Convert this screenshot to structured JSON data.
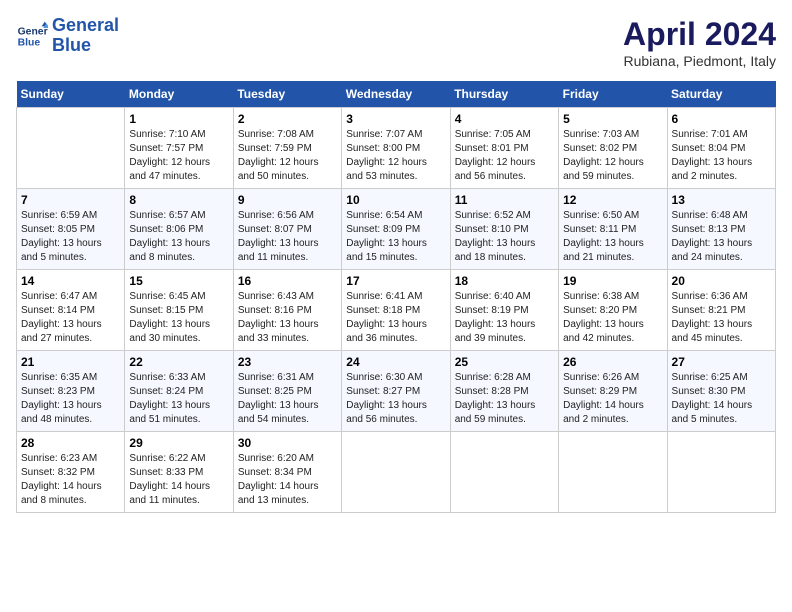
{
  "header": {
    "logo_line1": "General",
    "logo_line2": "Blue",
    "month": "April 2024",
    "location": "Rubiana, Piedmont, Italy"
  },
  "days_of_week": [
    "Sunday",
    "Monday",
    "Tuesday",
    "Wednesday",
    "Thursday",
    "Friday",
    "Saturday"
  ],
  "weeks": [
    [
      {
        "day": "",
        "info": ""
      },
      {
        "day": "1",
        "info": "Sunrise: 7:10 AM\nSunset: 7:57 PM\nDaylight: 12 hours\nand 47 minutes."
      },
      {
        "day": "2",
        "info": "Sunrise: 7:08 AM\nSunset: 7:59 PM\nDaylight: 12 hours\nand 50 minutes."
      },
      {
        "day": "3",
        "info": "Sunrise: 7:07 AM\nSunset: 8:00 PM\nDaylight: 12 hours\nand 53 minutes."
      },
      {
        "day": "4",
        "info": "Sunrise: 7:05 AM\nSunset: 8:01 PM\nDaylight: 12 hours\nand 56 minutes."
      },
      {
        "day": "5",
        "info": "Sunrise: 7:03 AM\nSunset: 8:02 PM\nDaylight: 12 hours\nand 59 minutes."
      },
      {
        "day": "6",
        "info": "Sunrise: 7:01 AM\nSunset: 8:04 PM\nDaylight: 13 hours\nand 2 minutes."
      }
    ],
    [
      {
        "day": "7",
        "info": "Sunrise: 6:59 AM\nSunset: 8:05 PM\nDaylight: 13 hours\nand 5 minutes."
      },
      {
        "day": "8",
        "info": "Sunrise: 6:57 AM\nSunset: 8:06 PM\nDaylight: 13 hours\nand 8 minutes."
      },
      {
        "day": "9",
        "info": "Sunrise: 6:56 AM\nSunset: 8:07 PM\nDaylight: 13 hours\nand 11 minutes."
      },
      {
        "day": "10",
        "info": "Sunrise: 6:54 AM\nSunset: 8:09 PM\nDaylight: 13 hours\nand 15 minutes."
      },
      {
        "day": "11",
        "info": "Sunrise: 6:52 AM\nSunset: 8:10 PM\nDaylight: 13 hours\nand 18 minutes."
      },
      {
        "day": "12",
        "info": "Sunrise: 6:50 AM\nSunset: 8:11 PM\nDaylight: 13 hours\nand 21 minutes."
      },
      {
        "day": "13",
        "info": "Sunrise: 6:48 AM\nSunset: 8:13 PM\nDaylight: 13 hours\nand 24 minutes."
      }
    ],
    [
      {
        "day": "14",
        "info": "Sunrise: 6:47 AM\nSunset: 8:14 PM\nDaylight: 13 hours\nand 27 minutes."
      },
      {
        "day": "15",
        "info": "Sunrise: 6:45 AM\nSunset: 8:15 PM\nDaylight: 13 hours\nand 30 minutes."
      },
      {
        "day": "16",
        "info": "Sunrise: 6:43 AM\nSunset: 8:16 PM\nDaylight: 13 hours\nand 33 minutes."
      },
      {
        "day": "17",
        "info": "Sunrise: 6:41 AM\nSunset: 8:18 PM\nDaylight: 13 hours\nand 36 minutes."
      },
      {
        "day": "18",
        "info": "Sunrise: 6:40 AM\nSunset: 8:19 PM\nDaylight: 13 hours\nand 39 minutes."
      },
      {
        "day": "19",
        "info": "Sunrise: 6:38 AM\nSunset: 8:20 PM\nDaylight: 13 hours\nand 42 minutes."
      },
      {
        "day": "20",
        "info": "Sunrise: 6:36 AM\nSunset: 8:21 PM\nDaylight: 13 hours\nand 45 minutes."
      }
    ],
    [
      {
        "day": "21",
        "info": "Sunrise: 6:35 AM\nSunset: 8:23 PM\nDaylight: 13 hours\nand 48 minutes."
      },
      {
        "day": "22",
        "info": "Sunrise: 6:33 AM\nSunset: 8:24 PM\nDaylight: 13 hours\nand 51 minutes."
      },
      {
        "day": "23",
        "info": "Sunrise: 6:31 AM\nSunset: 8:25 PM\nDaylight: 13 hours\nand 54 minutes."
      },
      {
        "day": "24",
        "info": "Sunrise: 6:30 AM\nSunset: 8:27 PM\nDaylight: 13 hours\nand 56 minutes."
      },
      {
        "day": "25",
        "info": "Sunrise: 6:28 AM\nSunset: 8:28 PM\nDaylight: 13 hours\nand 59 minutes."
      },
      {
        "day": "26",
        "info": "Sunrise: 6:26 AM\nSunset: 8:29 PM\nDaylight: 14 hours\nand 2 minutes."
      },
      {
        "day": "27",
        "info": "Sunrise: 6:25 AM\nSunset: 8:30 PM\nDaylight: 14 hours\nand 5 minutes."
      }
    ],
    [
      {
        "day": "28",
        "info": "Sunrise: 6:23 AM\nSunset: 8:32 PM\nDaylight: 14 hours\nand 8 minutes."
      },
      {
        "day": "29",
        "info": "Sunrise: 6:22 AM\nSunset: 8:33 PM\nDaylight: 14 hours\nand 11 minutes."
      },
      {
        "day": "30",
        "info": "Sunrise: 6:20 AM\nSunset: 8:34 PM\nDaylight: 14 hours\nand 13 minutes."
      },
      {
        "day": "",
        "info": ""
      },
      {
        "day": "",
        "info": ""
      },
      {
        "day": "",
        "info": ""
      },
      {
        "day": "",
        "info": ""
      }
    ]
  ]
}
